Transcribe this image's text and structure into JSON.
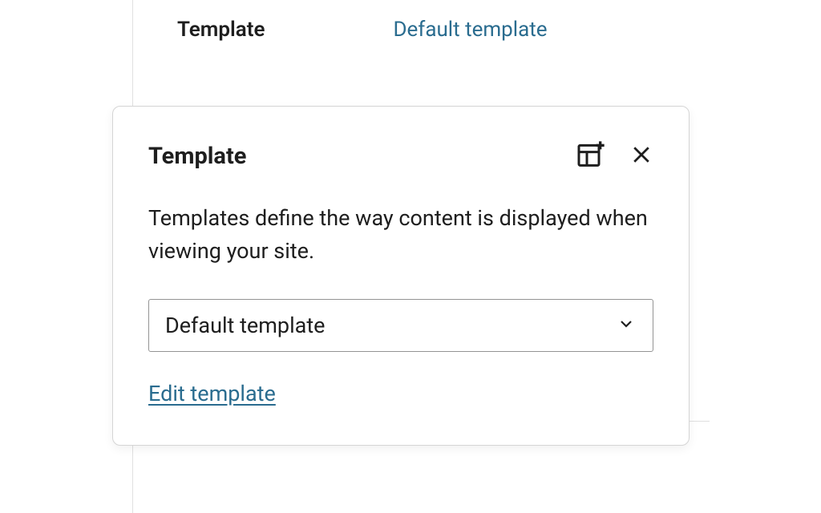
{
  "panel": {
    "label": "Template",
    "value": "Default template"
  },
  "popover": {
    "title": "Template",
    "description": "Templates define the way content is displayed when viewing your site.",
    "select_value": "Default template",
    "edit_link": "Edit template"
  }
}
